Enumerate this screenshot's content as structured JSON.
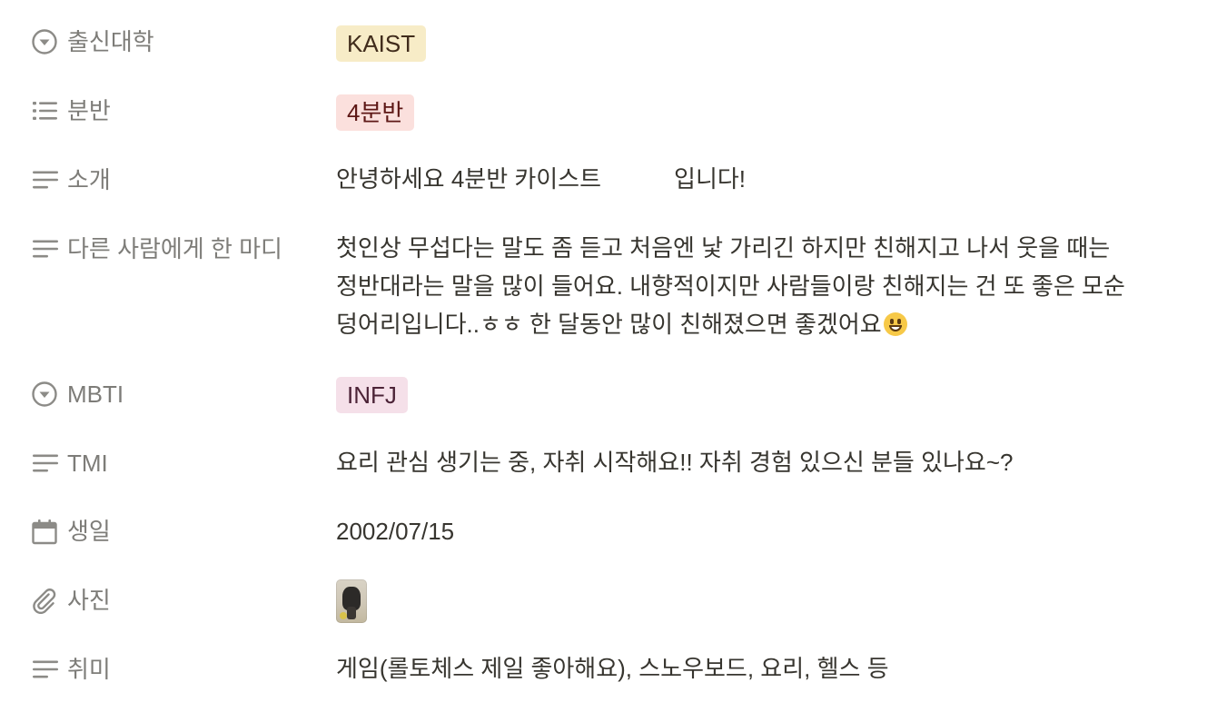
{
  "properties": {
    "university": {
      "label": "출신대학",
      "icon": "select-icon",
      "value": "KAIST",
      "tag_bg": "#f7ecc7",
      "tag_fg": "#402c1b"
    },
    "class": {
      "label": "분반",
      "icon": "multi-select-icon",
      "value": "4분반",
      "tag_bg": "#fbe0dd",
      "tag_fg": "#5d1715"
    },
    "intro": {
      "label": "소개",
      "icon": "text-icon",
      "value_part1": "안녕하세요 4분반 카이스트",
      "value_part2": "입니다!"
    },
    "message": {
      "label": "다른 사람에게 한 마디",
      "icon": "text-icon",
      "value": "첫인상 무섭다는 말도 좀 듣고 처음엔 낯 가리긴 하지만 친해지고 나서 웃을 때는 정반대라는 말을 많이 들어요. 내향적이지만 사람들이랑 친해지는 건 또 좋은 모순 덩어리입니다..ㅎㅎ 한 달동안 많이 친해졌으면 좋겠어요",
      "emoji": "grinning-face-emoji"
    },
    "mbti": {
      "label": "MBTI",
      "icon": "select-icon",
      "value": "INFJ",
      "tag_bg": "#f5e0e9",
      "tag_fg": "#4c2337"
    },
    "tmi": {
      "label": "TMI",
      "icon": "text-icon",
      "value": "요리 관심 생기는 중, 자취 시작해요!! 자취 경험 있으신 분들 있나요~?"
    },
    "birthday": {
      "label": "생일",
      "icon": "calendar-icon",
      "value": "2002/07/15"
    },
    "photo": {
      "label": "사진",
      "icon": "paperclip-icon"
    },
    "hobby": {
      "label": "취미",
      "icon": "text-icon",
      "value": "게임(롤토체스 제일 좋아해요), 스노우보드, 요리, 헬스 등"
    }
  },
  "colors": {
    "text": "#37352f",
    "label": "#8c8b87",
    "icon": "#8c8b87"
  }
}
